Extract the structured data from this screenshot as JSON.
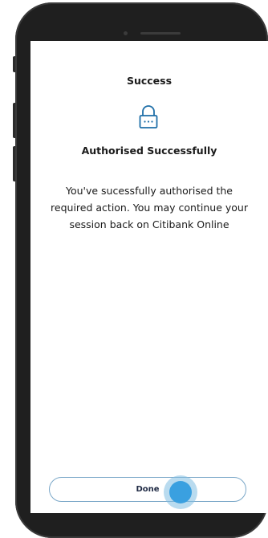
{
  "screen": {
    "title": "Success",
    "heading": "Authorised Successfully",
    "message": "You've sucessfully authorised the required action. You may continue your session back on Citibank Online",
    "done_label": "Done"
  },
  "icons": {
    "lock": "lock-icon"
  },
  "colors": {
    "accent": "#1f6fa8",
    "button_border": "#7aa7c8",
    "touch_indicator": "#3aa0e0"
  }
}
